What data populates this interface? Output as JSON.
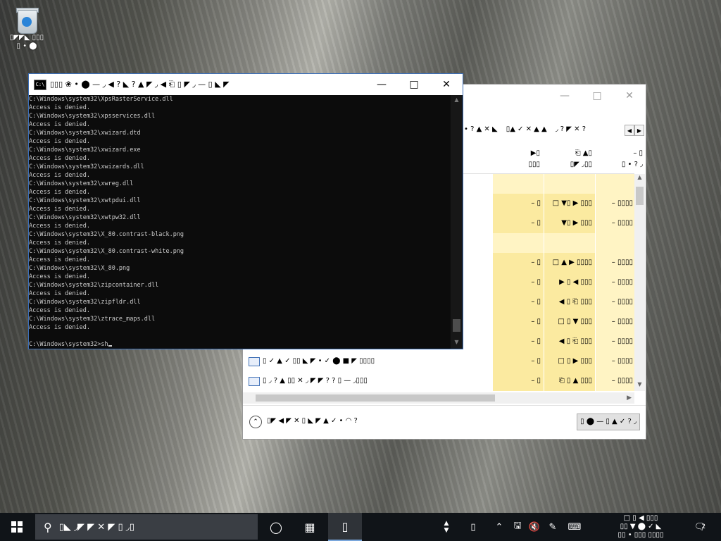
{
  "desktop": {
    "recycle_bin": {
      "label_line1": "▯◤◤◣ ▯▯▯",
      "label_line2": "▯ • ⬤"
    }
  },
  "back_window": {
    "tabs": [
      "• ? ▲ ✕ ◣",
      "▯▲ ✓ ✕ ▲ ▲",
      "◞ ? ◤ ✕ ?"
    ],
    "header": {
      "col1_top": "▶▯",
      "col1_bottom": "▯▯▯",
      "col2_top": "⎗ ▲▯",
      "col2_bottom": "▯◤ ◞▯▯",
      "col3_top": "– ▯",
      "col3_bottom": "▯ • ? ◞"
    },
    "rows": [
      {
        "name": "",
        "c1": "",
        "c2": "",
        "c3": "",
        "shade": false
      },
      {
        "name": "",
        "c1": "– ▯",
        "c2": "□ ▼▯ ▶ ▯▯▯",
        "c3": "– ▯▯▯▯",
        "shade": true
      },
      {
        "name": "",
        "c1": "– ▯",
        "c2": "▼▯ ▶ ▯▯▯",
        "c3": "– ▯▯▯▯",
        "shade": true
      },
      {
        "name": "",
        "c1": "",
        "c2": "",
        "c3": "",
        "shade": false
      },
      {
        "name": "",
        "c1": "– ▯",
        "c2": "□ ▲ ▶ ▯▯▯▯",
        "c3": "– ▯▯▯▯",
        "shade": true
      },
      {
        "name": "",
        "c1": "– ▯",
        "c2": "▶ ▯ ◀ ▯▯▯",
        "c3": "– ▯▯▯▯",
        "shade": true
      },
      {
        "name": "",
        "c1": "– ▯",
        "c2": "◀ ▯ ⎗ ▯▯▯",
        "c3": "– ▯▯▯▯",
        "shade": true
      },
      {
        "name": "",
        "c1": "– ▯",
        "c2": "□ ▯ ▼ ▯▯▯",
        "c3": "– ▯▯▯▯",
        "shade": true
      },
      {
        "name": "▯▯▯▯ ◞ —◤ ✕",
        "c1": "– ▯",
        "c2": "◀ ▯ ⎗ ▯▯▯",
        "c3": "– ▯▯▯▯",
        "shade": true
      },
      {
        "name": "▯ ✓ ▲ ✓ ▯▯ ◣ ◤ • ✓ ⬤ ■ ◤ ▯▯▯▯",
        "c1": "– ▯",
        "c2": "□ ▯ ▶ ▯▯▯",
        "c3": "– ▯▯▯▯",
        "shade": true
      },
      {
        "name": "▯ ◞ ? ▲ ▯▯ ✕ ◞ ◤ ◤ ? ? ▯ — ◞▯▯▯",
        "c1": "– ▯",
        "c2": "⎗ ▯ ▲ ▯▯▯",
        "c3": "– ▯▯▯▯",
        "shade": true
      }
    ],
    "footer": {
      "text": "▯◤ ◀ ◤ ✕ ▯ ◣ ◤ ▲ ✓ • ◠ ?",
      "button": "▯ ⬤ — ▯ ▲ ✓ ? ◞"
    }
  },
  "console": {
    "title": "▯▯▯ ❀ • ⬤ — ◞ ◀ ? ◣ ? ▲ ◤ ◞ ◀ ⎗ ▯ ◤ ◞ — ▯ ◣ ◤",
    "icon_text": "C:\\",
    "lines": [
      "C:\\Windows\\system32\\XpsRasterService.dll",
      "Access is denied.",
      "C:\\Windows\\system32\\xpsservices.dll",
      "Access is denied.",
      "C:\\Windows\\system32\\xwizard.dtd",
      "Access is denied.",
      "C:\\Windows\\system32\\xwizard.exe",
      "Access is denied.",
      "C:\\Windows\\system32\\xwizards.dll",
      "Access is denied.",
      "C:\\Windows\\system32\\xwreg.dll",
      "Access is denied.",
      "C:\\Windows\\system32\\xwtpdui.dll",
      "Access is denied.",
      "C:\\Windows\\system32\\xwtpw32.dll",
      "Access is denied.",
      "C:\\Windows\\system32\\X_80.contrast-black.png",
      "Access is denied.",
      "C:\\Windows\\system32\\X_80.contrast-white.png",
      "Access is denied.",
      "C:\\Windows\\system32\\X_80.png",
      "Access is denied.",
      "C:\\Windows\\system32\\zipcontainer.dll",
      "Access is denied.",
      "C:\\Windows\\system32\\zipfldr.dll",
      "Access is denied.",
      "C:\\Windows\\system32\\ztrace_maps.dll",
      "Access is denied.",
      ""
    ],
    "prompt": "C:\\Windows\\system32>sh"
  },
  "taskbar": {
    "search_text": "▯◣ ◞◤ ◤ ✕ ◤ ▯ ◞▯",
    "clock_line1": "□ ▯ ◀ ▯▯▯",
    "clock_line2": "▯▯ ▼ ⬤ ✓ ◣",
    "clock_line3": "▯▯ • ▯▯▯ ▯▯▯▯",
    "notification_count": "2"
  },
  "colors": {
    "console_bg": "#0c0c0c",
    "console_text": "#cccccc",
    "taskbar_bg": "#101418",
    "highlight_column": "#fff4c4"
  }
}
